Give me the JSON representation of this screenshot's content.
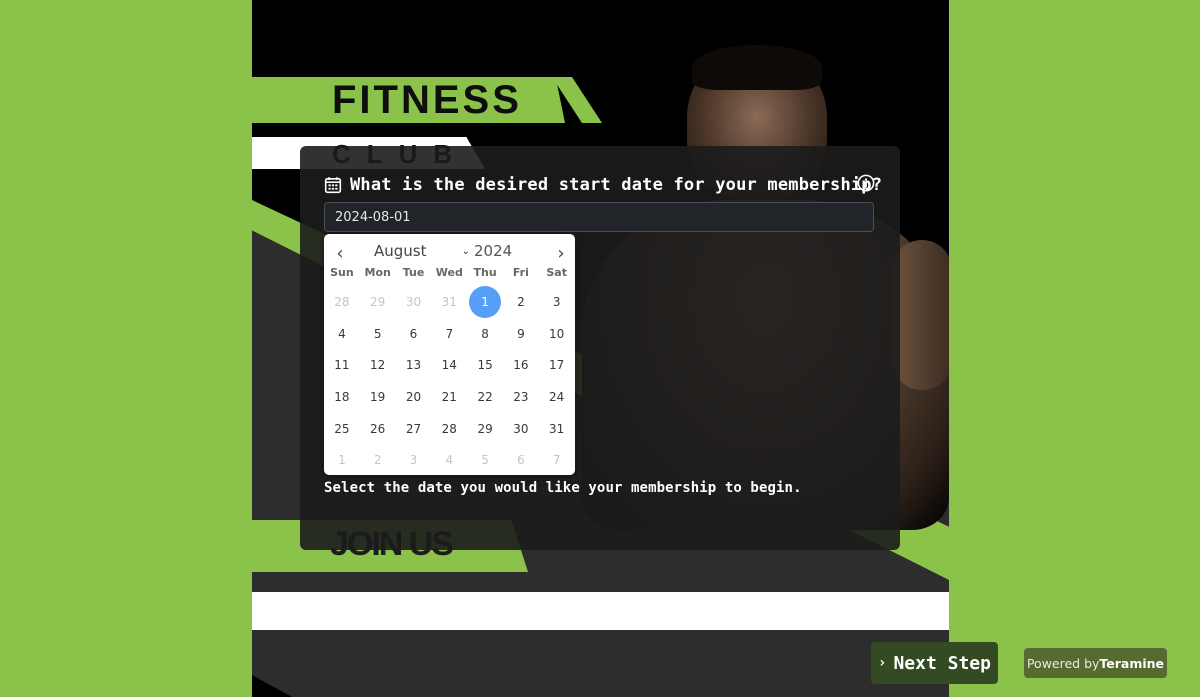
{
  "poster": {
    "title": "FITNESS",
    "subtitle": "CLUB",
    "cta": "JOIN US"
  },
  "question": {
    "icon": "calendar-icon",
    "text": "What is the desired start date for your membership?",
    "info_icon": "info-circle-icon",
    "input_value": "2024-08-01",
    "help_text": "Select the date you would like your membership to begin."
  },
  "datepicker": {
    "prev_label": "‹",
    "next_label": "›",
    "month": "August",
    "month_chevron": "⌄",
    "year": "2024",
    "weekdays": [
      "Sun",
      "Mon",
      "Tue",
      "Wed",
      "Thu",
      "Fri",
      "Sat"
    ],
    "selected_day": "1",
    "weeks": [
      [
        "28",
        "29",
        "30",
        "31",
        "1",
        "2",
        "3"
      ],
      [
        "4",
        "5",
        "6",
        "7",
        "8",
        "9",
        "10"
      ],
      [
        "11",
        "12",
        "13",
        "14",
        "15",
        "16",
        "17"
      ],
      [
        "18",
        "19",
        "20",
        "21",
        "22",
        "23",
        "24"
      ],
      [
        "25",
        "26",
        "27",
        "28",
        "29",
        "30",
        "31"
      ],
      [
        "1",
        "2",
        "3",
        "4",
        "5",
        "6",
        "7"
      ]
    ],
    "muted": [
      [
        true,
        true,
        true,
        true,
        false,
        false,
        false
      ],
      [
        false,
        false,
        false,
        false,
        false,
        false,
        false
      ],
      [
        false,
        false,
        false,
        false,
        false,
        false,
        false
      ],
      [
        false,
        false,
        false,
        false,
        false,
        false,
        false
      ],
      [
        false,
        false,
        false,
        false,
        false,
        false,
        false
      ],
      [
        true,
        true,
        true,
        true,
        true,
        true,
        true
      ]
    ],
    "selected_color": "#569ff7"
  },
  "footer": {
    "next_chevron": "›",
    "next_label": "Next Step",
    "powered_prefix": "Powered by",
    "powered_brand": "Teramine"
  },
  "colors": {
    "page_background": "#8bc34a",
    "accent_green": "#8bc34a",
    "next_button": "#344a22",
    "powered_badge": "#556b2f"
  }
}
